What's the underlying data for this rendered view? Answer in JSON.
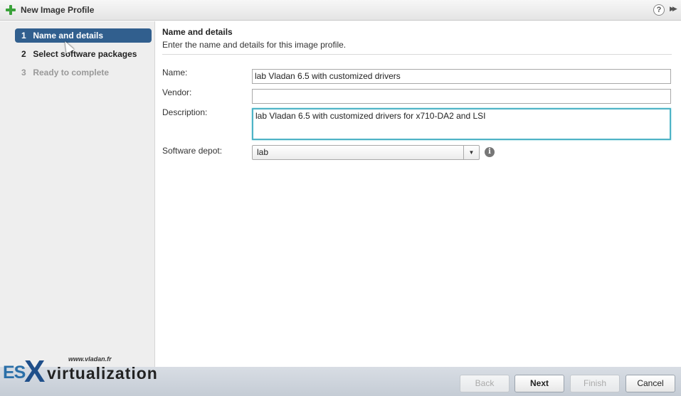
{
  "window": {
    "title": "New Image Profile",
    "help_glyph": "?",
    "expand_glyph": "▶▶"
  },
  "steps": [
    {
      "num": "1",
      "label": "Name and details",
      "state": "active"
    },
    {
      "num": "2",
      "label": "Select software packages",
      "state": "normal"
    },
    {
      "num": "3",
      "label": "Ready to complete",
      "state": "disabled"
    }
  ],
  "section": {
    "title": "Name and details",
    "subtitle": "Enter the name and details for this image profile."
  },
  "form": {
    "name_label": "Name:",
    "name_value": "lab Vladan 6.5 with customized drivers",
    "vendor_label": "Vendor:",
    "vendor_value": "",
    "description_label": "Description:",
    "description_value": "lab Vladan 6.5 with customized drivers for x710-DA2 and LSI",
    "depot_label": "Software depot:",
    "depot_value": "lab",
    "depot_arrow": "▼",
    "info_glyph": "i"
  },
  "footer": {
    "back_label": "Back",
    "next_label": "Next",
    "finish_label": "Finish",
    "cancel_label": "Cancel"
  },
  "watermark": {
    "url": "www.vladan.fr",
    "es": "ES",
    "x": "X",
    "virtualization": "virtualization"
  },
  "colors": {
    "active_step": "#315f8e",
    "focus_border": "#4db3c6",
    "add_icon": "#3aa23a"
  }
}
